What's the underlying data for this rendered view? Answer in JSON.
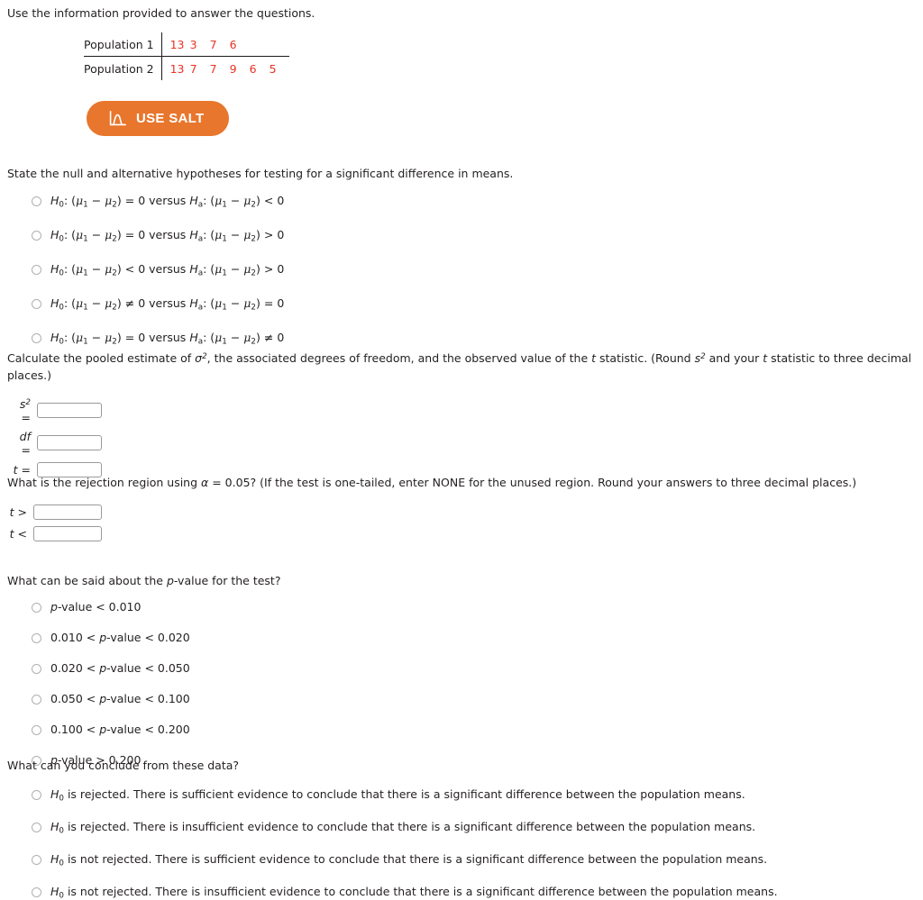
{
  "intro": "Use the information provided to answer the questions.",
  "data_table": {
    "rows": [
      {
        "label": "Population 1",
        "values": [
          "13",
          "3",
          "7",
          "6"
        ]
      },
      {
        "label": "Population 2",
        "values": [
          "13",
          "7",
          "7",
          "9",
          "6",
          "5"
        ]
      }
    ],
    "value_color": "#ea3323"
  },
  "salt_button": {
    "label": "USE SALT",
    "icon": "distribution-curve-icon",
    "background": "#e8762c",
    "text_color": "#ffffff"
  },
  "q_hypotheses": {
    "prompt": "State the null and alternative hypotheses for testing for a significant difference in means.",
    "options": [
      {
        "null_rel": "=",
        "null_rhs": "0",
        "alt_rel": "<",
        "alt_rhs": "0"
      },
      {
        "null_rel": "=",
        "null_rhs": "0",
        "alt_rel": ">",
        "alt_rhs": "0"
      },
      {
        "null_rel": "<",
        "null_rhs": "0",
        "alt_rel": ">",
        "alt_rhs": "0"
      },
      {
        "null_rel": "≠",
        "null_rhs": "0",
        "alt_rel": "=",
        "alt_rhs": "0"
      },
      {
        "null_rel": "=",
        "null_rhs": "0",
        "alt_rel": "≠",
        "alt_rhs": "0"
      }
    ],
    "versus_word": "versus",
    "h_null_symbol": "H",
    "h_null_sub": "0",
    "h_alt_symbol": "H",
    "h_alt_sub": "a",
    "mu1_sub": "1",
    "mu2_sub": "2"
  },
  "q_pooled": {
    "prompt_part1": "Calculate the pooled estimate of ",
    "sigma_symbol": "σ",
    "sigma_exp": "2",
    "prompt_part2": ", the associated degrees of freedom, and the observed value of the ",
    "t_symbol": "t",
    "prompt_part3": " statistic. (Round ",
    "s_symbol": "s",
    "s_exp": "2",
    "prompt_part4": " and your ",
    "prompt_part5": " statistic to three decimal places.)",
    "fields": [
      {
        "label": "s",
        "exp": "2",
        "eq": "=",
        "value": "",
        "name": "s-squared"
      },
      {
        "label": "df",
        "exp": "",
        "eq": "=",
        "value": "",
        "name": "df"
      },
      {
        "label": "t",
        "exp": "",
        "eq": "=",
        "value": "",
        "name": "t-statistic"
      }
    ]
  },
  "q_rejection": {
    "prompt_part1": "What is the rejection region using ",
    "alpha_symbol": "α",
    "prompt_part2": " = 0.05? (If the test is one-tailed, enter NONE for the unused region. Round your answers to three decimal places.)",
    "fields": [
      {
        "label": "t",
        "rel": ">",
        "value": "",
        "name": "t-greater-than"
      },
      {
        "label": "t",
        "rel": "<",
        "value": "",
        "name": "t-less-than"
      }
    ]
  },
  "q_pvalue": {
    "prompt_pre": "What can be said about the ",
    "prompt_p": "p",
    "prompt_post": "-value for the test?",
    "options": [
      {
        "pre": "",
        "p": "p",
        "post": "-value < 0.010"
      },
      {
        "pre": "0.010 < ",
        "p": "p",
        "post": "-value < 0.020"
      },
      {
        "pre": "0.020 < ",
        "p": "p",
        "post": "-value < 0.050"
      },
      {
        "pre": "0.050 < ",
        "p": "p",
        "post": "-value < 0.100"
      },
      {
        "pre": "0.100 < ",
        "p": "p",
        "post": "-value < 0.200"
      },
      {
        "pre": "",
        "p": "p",
        "post": "-value > 0.200"
      }
    ]
  },
  "q_conclude": {
    "prompt": "What can you conclude from these data?",
    "options": [
      {
        "h": "H",
        "sub": "0",
        "text": " is rejected. There is sufficient evidence to conclude that there is a significant difference between the population means."
      },
      {
        "h": "H",
        "sub": "0",
        "text": " is rejected. There is insufficient evidence to conclude that there is a significant difference between the population means."
      },
      {
        "h": "H",
        "sub": "0",
        "text": " is not rejected. There is sufficient evidence to conclude that there is a significant difference between the population means."
      },
      {
        "h": "H",
        "sub": "0",
        "text": " is not rejected. There is insufficient evidence to conclude that there is a significant difference between the population means."
      }
    ]
  }
}
